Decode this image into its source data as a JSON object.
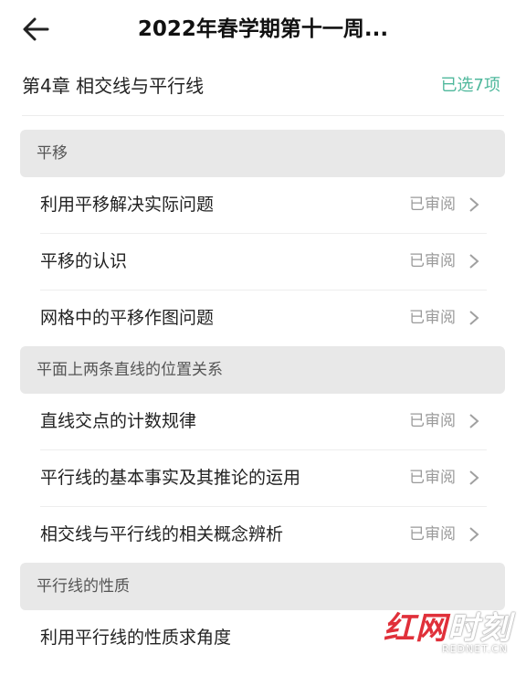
{
  "header": {
    "title": "2022年春学期第十一周..."
  },
  "chapter": {
    "title": "第4章 相交线与平行线",
    "selected": "已选7项"
  },
  "groups": [
    {
      "label": "平移",
      "items": [
        {
          "label": "利用平移解决实际问题",
          "status": "已审阅"
        },
        {
          "label": "平移的认识",
          "status": "已审阅"
        },
        {
          "label": "网格中的平移作图问题",
          "status": "已审阅"
        }
      ]
    },
    {
      "label": "平面上两条直线的位置关系",
      "items": [
        {
          "label": "直线交点的计数规律",
          "status": "已审阅"
        },
        {
          "label": "平行线的基本事实及其推论的运用",
          "status": "已审阅"
        },
        {
          "label": "相交线与平行线的相关概念辨析",
          "status": "已审阅"
        }
      ]
    },
    {
      "label": "平行线的性质",
      "items": [
        {
          "label": "利用平行线的性质求角度",
          "status": ""
        }
      ]
    }
  ],
  "watermark": {
    "part1": "红网",
    "part2": "时刻",
    "sub": "REDNET.CN"
  },
  "icons": {
    "back": "back-arrow-icon",
    "chevron": "chevron-right-icon"
  },
  "colors": {
    "accent": "#4fb89c",
    "group_bg": "#e8e8e8",
    "watermark": "#e0303a"
  }
}
